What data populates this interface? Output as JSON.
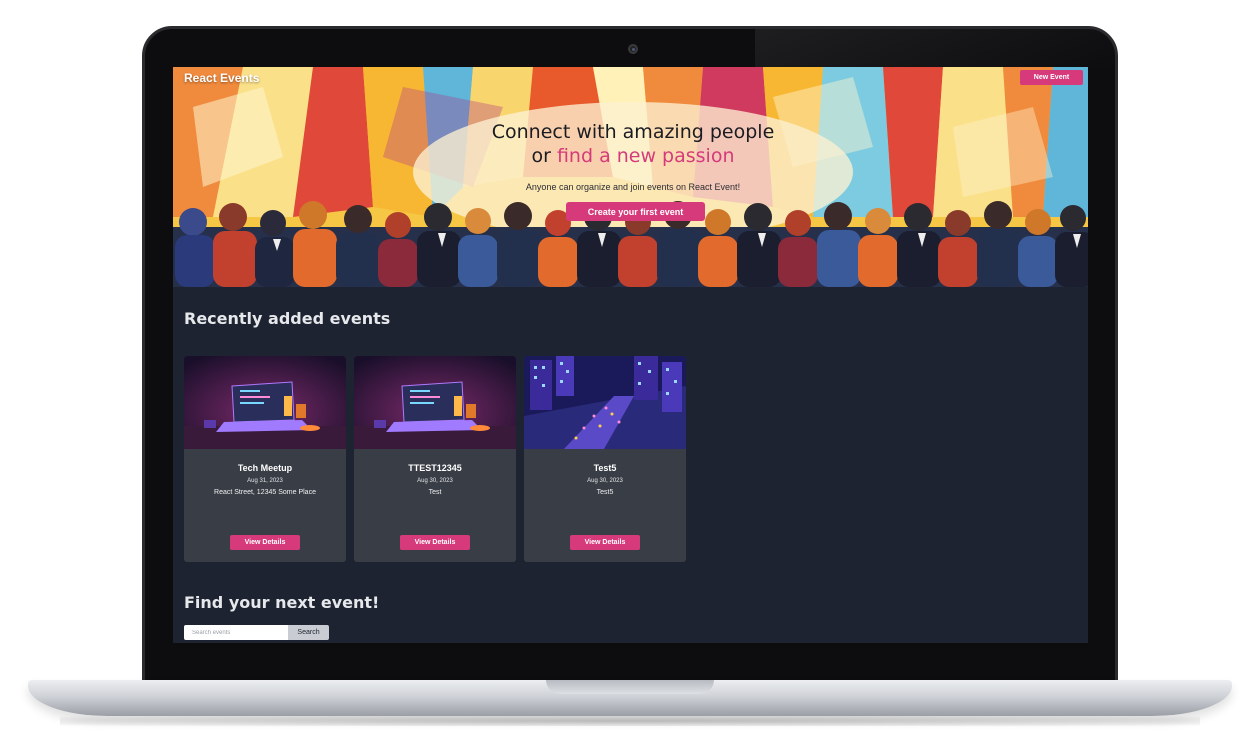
{
  "app": {
    "brand": "React Events"
  },
  "header": {
    "new_event_label": "New Event"
  },
  "hero": {
    "headline_line1": "Connect with amazing people",
    "headline_line2_prefix": "or ",
    "headline_line2_accent": "find a new passion",
    "subline": "Anyone can organize and join events on React Event!",
    "cta_label": "Create your first event"
  },
  "recent": {
    "title": "Recently added events",
    "events": [
      {
        "title": "Tech Meetup",
        "date": "Aug 31, 2023",
        "place": "React Street, 12345 Some Place",
        "button": "View Details",
        "image": "laptop-illustration"
      },
      {
        "title": "TTEST12345",
        "date": "Aug 30, 2023",
        "place": "Test",
        "button": "View Details",
        "image": "laptop-illustration"
      },
      {
        "title": "Test5",
        "date": "Aug 30, 2023",
        "place": "Test5",
        "button": "View Details",
        "image": "city-night-illustration"
      }
    ]
  },
  "find": {
    "title": "Find your next event!",
    "search_placeholder": "Search events",
    "search_value": "",
    "search_button": "Search"
  },
  "colors": {
    "accent": "#d63a7b",
    "page_bg": "#1d2330",
    "card_bg": "#393d45"
  }
}
